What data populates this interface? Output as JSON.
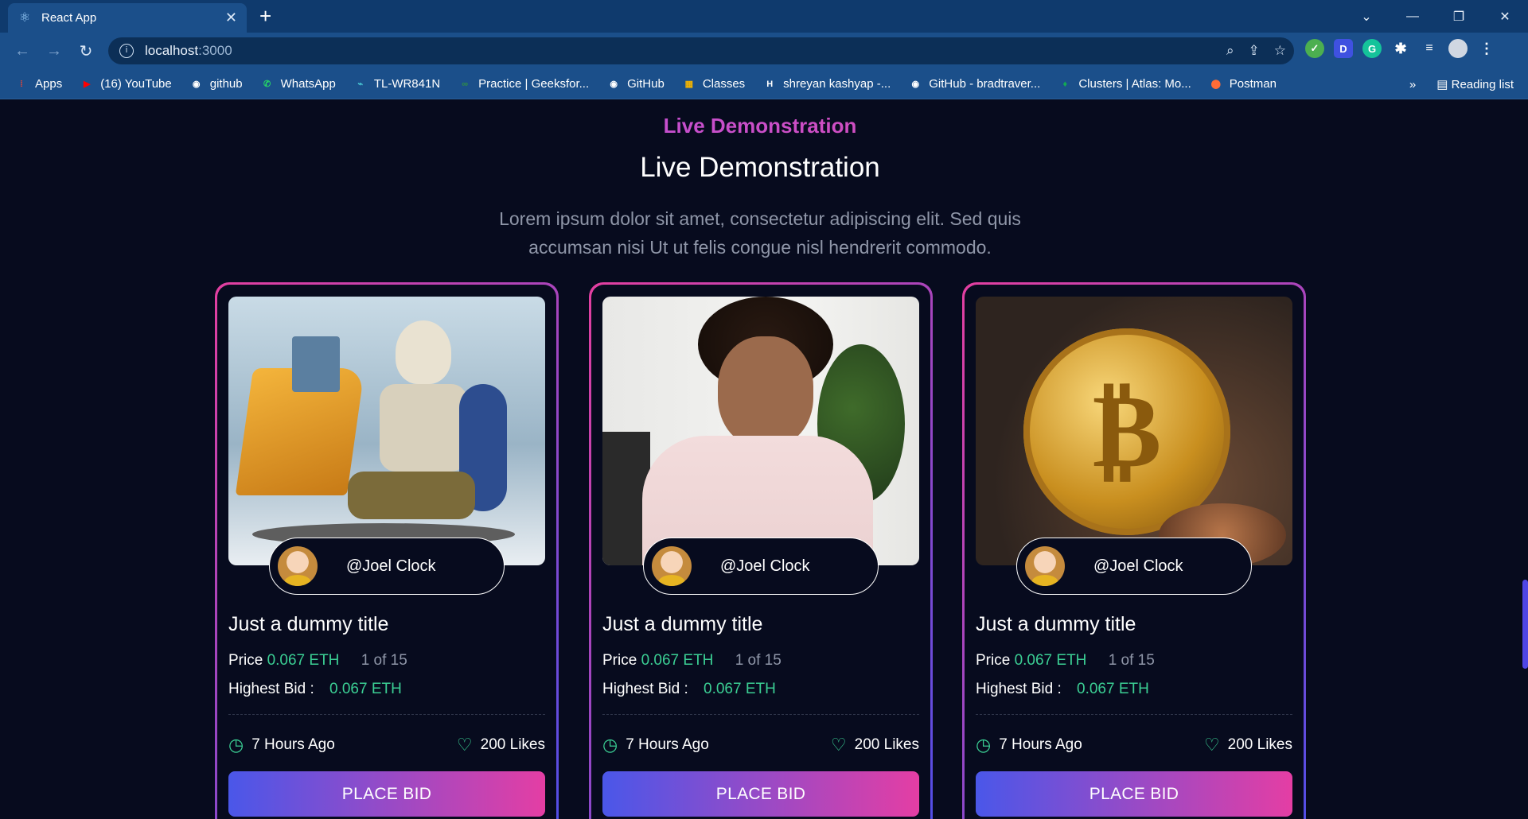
{
  "browser": {
    "tab_title": "React App",
    "url_host": "localhost",
    "url_port": ":3000",
    "bookmarks": [
      {
        "label": "Apps",
        "icon": "apps-grid-icon",
        "color": "#ea4335"
      },
      {
        "label": "(16) YouTube",
        "icon": "youtube-icon",
        "color": "#ff0000"
      },
      {
        "label": "github",
        "icon": "github-icon",
        "color": "#ffffff"
      },
      {
        "label": "WhatsApp",
        "icon": "whatsapp-icon",
        "color": "#25d366"
      },
      {
        "label": "TL-WR841N",
        "icon": "tplink-icon",
        "color": "#4acbd6"
      },
      {
        "label": "Practice | Geeksfor...",
        "icon": "geeksforgeeks-icon",
        "color": "#2f8d46"
      },
      {
        "label": "GitHub",
        "icon": "github-icon",
        "color": "#ffffff"
      },
      {
        "label": "Classes",
        "icon": "classroom-icon",
        "color": "#f4b400"
      },
      {
        "label": "shreyan kashyap -...",
        "icon": "hackerrank-icon",
        "color": "#ffffff"
      },
      {
        "label": "GitHub - bradtraver...",
        "icon": "github-icon",
        "color": "#ffffff"
      },
      {
        "label": "Clusters | Atlas: Mo...",
        "icon": "mongodb-leaf-icon",
        "color": "#13aa52"
      },
      {
        "label": "Postman",
        "icon": "postman-icon",
        "color": "#ff6c37"
      }
    ],
    "more_label": "»",
    "reading_list": "Reading list"
  },
  "section": {
    "kicker": "Live Demonstration",
    "title": "Live Demonstration",
    "description": "Lorem ipsum dolor sit amet, consectetur adipiscing elit. Sed quis accumsan nisi Ut ut felis congue nisl hendrerit commodo."
  },
  "cards": [
    {
      "image": "skeleton-at-computer",
      "creator": "@Joel Clock",
      "title": "Just a dummy title",
      "price_label": "Price",
      "price": "0.067 ETH",
      "edition": "1 of 15",
      "bid_label": "Highest Bid :",
      "bid": "0.067 ETH",
      "time": "7 Hours Ago",
      "likes": "200 Likes",
      "button": "PLACE BID"
    },
    {
      "image": "woman-reading",
      "creator": "@Joel Clock",
      "title": "Just a dummy title",
      "price_label": "Price",
      "price": "0.067 ETH",
      "edition": "1 of 15",
      "bid_label": "Highest Bid :",
      "bid": "0.067 ETH",
      "time": "7 Hours Ago",
      "likes": "200 Likes",
      "button": "PLACE BID"
    },
    {
      "image": "bitcoin-coin",
      "creator": "@Joel Clock",
      "title": "Just a dummy title",
      "price_label": "Price",
      "price": "0.067 ETH",
      "edition": "1 of 15",
      "bid_label": "Highest Bid :",
      "bid": "0.067 ETH",
      "time": "7 Hours Ago",
      "likes": "200 Likes",
      "button": "PLACE BID"
    }
  ],
  "colors": {
    "accent_green": "#3bcf94",
    "gradient_start": "#4a57e9",
    "gradient_end": "#e43ea4",
    "page_bg": "#070b1e"
  }
}
